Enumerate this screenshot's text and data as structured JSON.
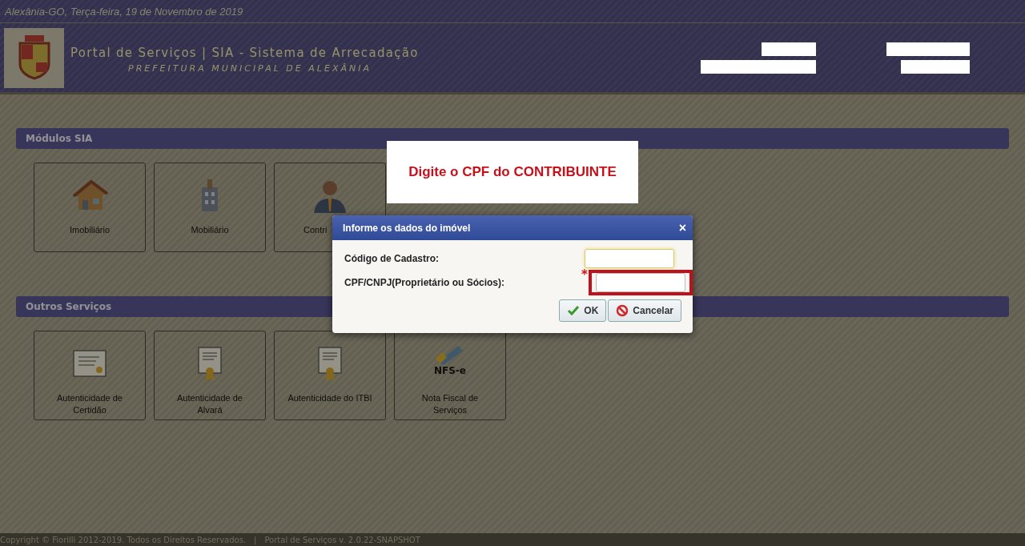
{
  "top_bar": {
    "date": "Alexânia-GO, Terça-feira, 19 de Novembro de 2019"
  },
  "header": {
    "title": "Portal de Serviços | SIA - Sistema de Arrecadação",
    "subtitle": "PREFEITURA MUNICIPAL DE ALEXÂNIA"
  },
  "sections": [
    {
      "title": "Módulos SIA",
      "tiles": [
        {
          "label": "Imobiliário",
          "kind": "house"
        },
        {
          "label": "Mobiliário",
          "kind": "building"
        },
        {
          "label": "Contri",
          "kind": "person",
          "clipped": true
        }
      ]
    },
    {
      "title": "Outros Serviços",
      "tiles": [
        {
          "label": "Autenticidade de\nCertidão",
          "kind": "certificate"
        },
        {
          "label": "Autenticidade de\nAlvará",
          "kind": "award"
        },
        {
          "label": "Autenticidade do ITBI",
          "kind": "award"
        },
        {
          "label": "Nota Fiscal de\nServiços",
          "kind": "nfse",
          "badge": "NFS-e"
        }
      ]
    }
  ],
  "footer": {
    "copyright": "Copyright © Fiorilli 2012-2019. Todos os Direitos Reservados.",
    "separator": "|",
    "version": "Portal de Serviços v. 2.0.22-SNAPSHOT"
  },
  "callout": {
    "text": "Digite o CPF do CONTRIBUINTE"
  },
  "dialog": {
    "title": "Informe os dados do imóvel",
    "close": "×",
    "fields": [
      {
        "label": "Código de Cadastro:",
        "focused": true,
        "highlighted": false
      },
      {
        "label": "CPF/CNPJ(Proprietário ou Sócios):",
        "required_mark": "*",
        "focused": false,
        "highlighted": true
      }
    ],
    "buttons": [
      {
        "label": "OK",
        "kind": "ok"
      },
      {
        "label": "Cancelar",
        "kind": "cancel"
      }
    ]
  }
}
